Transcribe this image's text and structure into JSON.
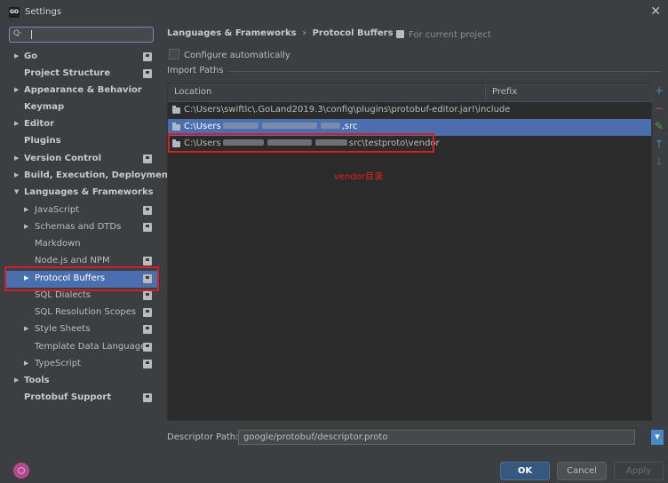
{
  "window": {
    "title": "Settings",
    "app_icon": "GO",
    "close": "✕"
  },
  "search": {
    "value": "",
    "placeholder": ""
  },
  "tree": [
    {
      "label": "Go",
      "arrow": "▶",
      "badge": true
    },
    {
      "label": "Project Structure",
      "badge": true
    },
    {
      "label": "Appearance & Behavior",
      "arrow": "▶"
    },
    {
      "label": "Keymap"
    },
    {
      "label": "Editor",
      "arrow": "▶"
    },
    {
      "label": "Plugins"
    },
    {
      "label": "Version Control",
      "arrow": "▶",
      "badge": true
    },
    {
      "label": "Build, Execution, Deployment",
      "arrow": "▶"
    },
    {
      "label": "Languages & Frameworks",
      "arrow": "▼"
    },
    {
      "label": "JavaScript",
      "arrow": "▶",
      "badge": true
    },
    {
      "label": "Schemas and DTDs",
      "arrow": "▶",
      "badge": true
    },
    {
      "label": "Markdown"
    },
    {
      "label": "Node.js and NPM",
      "badge": true
    },
    {
      "label": "Protocol Buffers",
      "arrow": "▶",
      "badge": true,
      "selected": true
    },
    {
      "label": "SQL Dialects",
      "badge": true
    },
    {
      "label": "SQL Resolution Scopes",
      "badge": true
    },
    {
      "label": "Style Sheets",
      "arrow": "▶",
      "badge": true
    },
    {
      "label": "Template Data Languages",
      "badge": true
    },
    {
      "label": "TypeScript",
      "arrow": "▶",
      "badge": true
    },
    {
      "label": "Tools",
      "arrow": "▶"
    },
    {
      "label": "Protobuf Support",
      "badge": true
    }
  ],
  "breadcrumb": {
    "parent": "Languages & Frameworks",
    "separator": "›",
    "current": "Protocol Buffers"
  },
  "scope_label": "For current project",
  "configure_auto": {
    "label": "Configure automatically",
    "checked": false
  },
  "import_paths": {
    "title": "Import Paths",
    "columns": {
      "location": "Location",
      "prefix": "Prefix"
    },
    "rows": [
      {
        "prefix_text": "C:\\Users\\swiftlc\\.GoLand2019.3\\config\\plugins\\protobuf-editor.jar!\\include",
        "suffix_text": ""
      },
      {
        "prefix_text": "C:\\Users",
        "suffix_text": "src",
        "selected": true
      },
      {
        "prefix_text": "C:\\Users",
        "suffix_text": "src\\testproto\\vendor"
      }
    ]
  },
  "annotation": "vendor目录",
  "side_tools": [
    "+",
    "−",
    "✎",
    "↑",
    "↓"
  ],
  "descriptor": {
    "label": "Descriptor Path:",
    "value": "google/protobuf/descriptor.proto",
    "dropdown": "▼"
  },
  "buttons": {
    "ok": "OK",
    "cancel": "Cancel",
    "apply": "Apply"
  }
}
